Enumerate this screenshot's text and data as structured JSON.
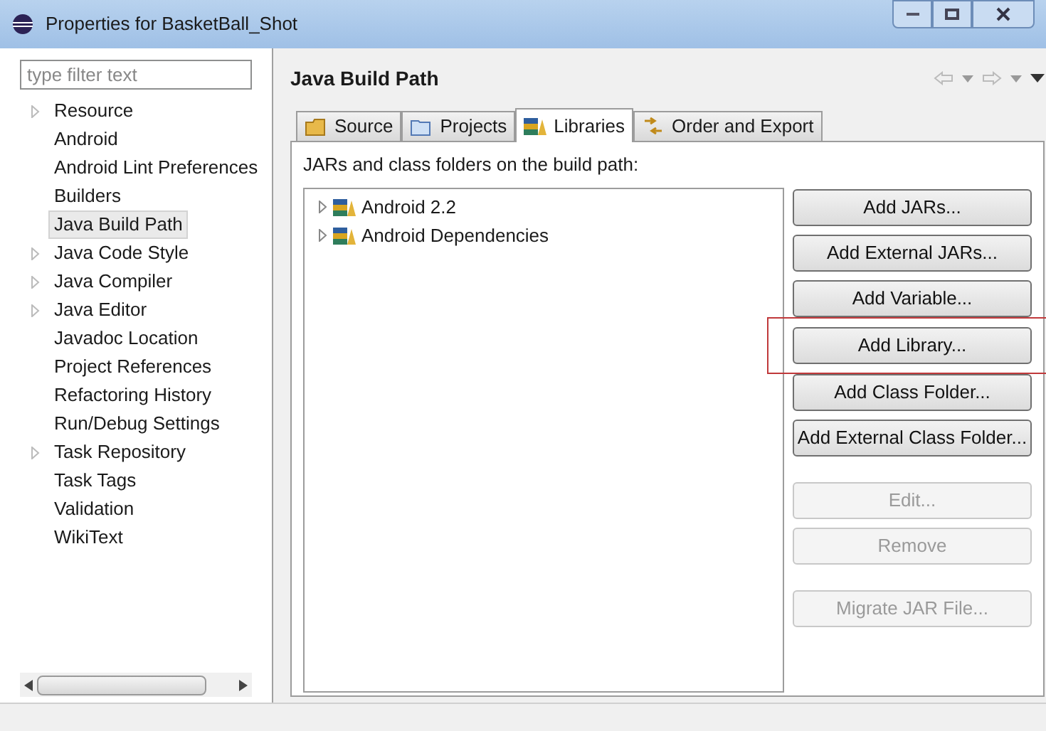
{
  "window": {
    "title": "Properties for BasketBall_Shot"
  },
  "filter": {
    "placeholder": "type filter text"
  },
  "sidebar": {
    "items": [
      {
        "label": "Resource",
        "expandable": true,
        "selected": false
      },
      {
        "label": "Android",
        "expandable": false,
        "selected": false
      },
      {
        "label": "Android Lint Preferences",
        "expandable": false,
        "selected": false
      },
      {
        "label": "Builders",
        "expandable": false,
        "selected": false
      },
      {
        "label": "Java Build Path",
        "expandable": false,
        "selected": true
      },
      {
        "label": "Java Code Style",
        "expandable": true,
        "selected": false
      },
      {
        "label": "Java Compiler",
        "expandable": true,
        "selected": false
      },
      {
        "label": "Java Editor",
        "expandable": true,
        "selected": false
      },
      {
        "label": "Javadoc Location",
        "expandable": false,
        "selected": false
      },
      {
        "label": "Project References",
        "expandable": false,
        "selected": false
      },
      {
        "label": "Refactoring History",
        "expandable": false,
        "selected": false
      },
      {
        "label": "Run/Debug Settings",
        "expandable": false,
        "selected": false
      },
      {
        "label": "Task Repository",
        "expandable": true,
        "selected": false
      },
      {
        "label": "Task Tags",
        "expandable": false,
        "selected": false
      },
      {
        "label": "Validation",
        "expandable": false,
        "selected": false
      },
      {
        "label": "WikiText",
        "expandable": false,
        "selected": false
      }
    ]
  },
  "page": {
    "title": "Java Build Path"
  },
  "tabs": [
    {
      "label": "Source",
      "selected": false
    },
    {
      "label": "Projects",
      "selected": false
    },
    {
      "label": "Libraries",
      "selected": true
    },
    {
      "label": "Order and Export",
      "selected": false
    }
  ],
  "libraries": {
    "caption": "JARs and class folders on the build path:",
    "items": [
      {
        "label": "Android 2.2"
      },
      {
        "label": "Android Dependencies"
      }
    ]
  },
  "button_groups": [
    [
      {
        "label": "Add JARs...",
        "disabled": false,
        "highlighted": false
      },
      {
        "label": "Add External JARs...",
        "disabled": false,
        "highlighted": false
      },
      {
        "label": "Add Variable...",
        "disabled": false,
        "highlighted": false
      },
      {
        "label": "Add Library...",
        "disabled": false,
        "highlighted": true
      },
      {
        "label": "Add Class Folder...",
        "disabled": false,
        "highlighted": false
      },
      {
        "label": "Add External Class Folder...",
        "disabled": false,
        "highlighted": false
      }
    ],
    [
      {
        "label": "Edit...",
        "disabled": true,
        "highlighted": false
      },
      {
        "label": "Remove",
        "disabled": true,
        "highlighted": false
      }
    ],
    [
      {
        "label": "Migrate JAR File...",
        "disabled": true,
        "highlighted": false
      }
    ]
  ]
}
